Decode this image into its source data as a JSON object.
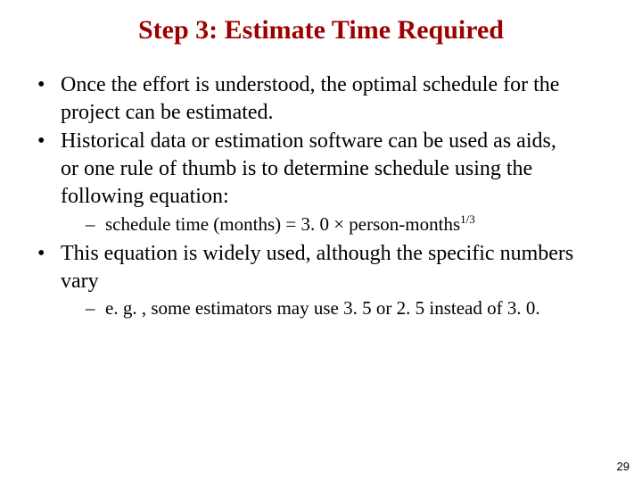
{
  "title": "Step 3: Estimate Time Required",
  "bullets": {
    "b1": "Once the effort is understood, the optimal schedule for the project can be estimated.",
    "b2_line1": "Historical data or estimation software can be used as aids,",
    "b2_line2": "or one rule of thumb is to determine schedule using the following equation:",
    "b2_sub_prefix": "schedule time (months) = 3. 0 × person-months",
    "b2_sub_exp": "1/3",
    "b3": "This equation is widely used, although the specific numbers vary",
    "b3_sub": "e. g. , some estimators may use 3. 5 or 2. 5 instead of 3. 0."
  },
  "page_number": "29"
}
